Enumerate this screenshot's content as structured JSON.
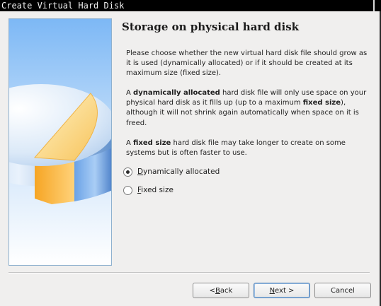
{
  "window": {
    "title": "Create Virtual Hard Disk"
  },
  "page": {
    "heading": "Storage on physical hard disk",
    "intro": "Please choose whether the new virtual hard disk file should grow as it is used (dynamically allocated) or if it should be created at its maximum size (fixed size).",
    "dynamic_para": {
      "prefix": "A ",
      "bold1": "dynamically allocated",
      "mid": " hard disk file will only use space on your physical hard disk as it fills up (up to a maximum ",
      "bold2": "fixed size",
      "suffix": "), although it will not shrink again automatically when space on it is freed."
    },
    "fixed_para": {
      "prefix": "A ",
      "bold": "fixed size",
      "suffix": " hard disk file may take longer to create on some systems but is often faster to use."
    }
  },
  "options": {
    "dynamic": {
      "mnemonic": "D",
      "rest": "ynamically allocated",
      "selected": true
    },
    "fixed": {
      "mnemonic": "F",
      "rest": "ixed size",
      "selected": false
    }
  },
  "buttons": {
    "back": {
      "pre": "< ",
      "mnemonic": "B",
      "post": "ack"
    },
    "next": {
      "pre": "",
      "mnemonic": "N",
      "post": "ext >"
    },
    "cancel": {
      "label": "Cancel"
    }
  },
  "colors": {
    "accent_blue": "#4f8fd8",
    "accent_orange": "#f7a52c",
    "wizard_bg_top": "#7db8f5"
  },
  "icons": {
    "watermark": "hard-disk-pie-illustration"
  }
}
